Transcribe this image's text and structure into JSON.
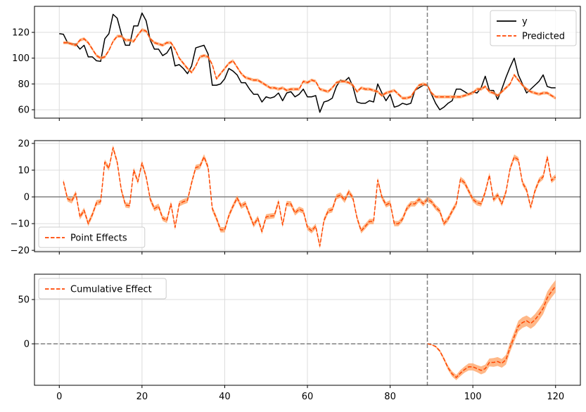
{
  "chart_data": [
    {
      "type": "line",
      "panel": "top",
      "xlim": [
        -6,
        126
      ],
      "ylim": [
        53.5,
        140.2
      ],
      "xticks": [
        0,
        20,
        40,
        60,
        80,
        100,
        120
      ],
      "yticks": [
        60,
        80,
        100,
        120
      ],
      "grid": true,
      "legend_placement": "top-right",
      "intervention_x": 89,
      "series": [
        {
          "name": "y",
          "color": "#000000",
          "style": "solid",
          "x_start": 0,
          "values": [
            119,
            118.5,
            112,
            111,
            111,
            107,
            110,
            101,
            101,
            98,
            97.5,
            115,
            119,
            134,
            131,
            119,
            110,
            110,
            125,
            125,
            135,
            129,
            114,
            107,
            107,
            102,
            104,
            109,
            94,
            95,
            92,
            88,
            94,
            108,
            109,
            110,
            103,
            79,
            79,
            80,
            84,
            92,
            90,
            87,
            81,
            81,
            76,
            72,
            72,
            66,
            70,
            69,
            70,
            73,
            67,
            73,
            74,
            70,
            72,
            76,
            70,
            70,
            71,
            58,
            66,
            67,
            69,
            78,
            83,
            82,
            85,
            78,
            66,
            65,
            65,
            67,
            66,
            80,
            73,
            67,
            72,
            62,
            63,
            65,
            64,
            65,
            75,
            77,
            79,
            79,
            72,
            65,
            60,
            62,
            65,
            67,
            76,
            76,
            74,
            72,
            74,
            73,
            77,
            86,
            75,
            75,
            68,
            76,
            85,
            93,
            100,
            87,
            80,
            73,
            76,
            79,
            82,
            87,
            78,
            77,
            77
          ]
        },
        {
          "name": "Predicted",
          "color": "#ff4500",
          "style": "dashed",
          "x_start": 1,
          "band_halfwidth": 1.2,
          "band_color": "#ffa060",
          "values": [
            112,
            112,
            111,
            110,
            114,
            115,
            112,
            107,
            102,
            100,
            101,
            106,
            113,
            117,
            117,
            114,
            114,
            113,
            118,
            122,
            121,
            115,
            112,
            111,
            110,
            112,
            112,
            107,
            100,
            96,
            92,
            89,
            94,
            101,
            102,
            101,
            95,
            84,
            88,
            92,
            96,
            98,
            93,
            88,
            85,
            84,
            83,
            83,
            81,
            79,
            77,
            77,
            76,
            77,
            75,
            76,
            76,
            76,
            82,
            81,
            83,
            82,
            76,
            75,
            74,
            77,
            81,
            82,
            82,
            81,
            79,
            74,
            77,
            76,
            76,
            75,
            74,
            71,
            73,
            74,
            75,
            72,
            69,
            69,
            70,
            75,
            79,
            80,
            79,
            73,
            70,
            70,
            70,
            70,
            70,
            70,
            70,
            71,
            72,
            73,
            76,
            76,
            78,
            74,
            73,
            71,
            74,
            77,
            80,
            87,
            83,
            79,
            76,
            74,
            73,
            72,
            73,
            73,
            71,
            69
          ]
        }
      ]
    },
    {
      "type": "line",
      "panel": "middle",
      "xlim": [
        -6,
        126
      ],
      "ylim": [
        -20.5,
        21.05
      ],
      "xticks": [
        0,
        20,
        40,
        60,
        80,
        100,
        120
      ],
      "yticks": [
        -20,
        -10,
        0,
        10,
        20
      ],
      "grid": true,
      "legend_placement": "lower-left",
      "intervention_x": 89,
      "zero_line": "solid",
      "series": [
        {
          "name": "Point Effects",
          "color": "#ff4500",
          "style": "dashed",
          "x_start": 1,
          "band_halfwidth": 1.0,
          "band_color": "#ffa060",
          "values": [
            5.7,
            -0.7,
            -1.5,
            1.3,
            -7.5,
            -5,
            -10,
            -6.6,
            -2.2,
            -1.8,
            13,
            10.7,
            18.4,
            13,
            2.6,
            -3,
            -3.3,
            10,
            5.7,
            12.7,
            7.5,
            -0.9,
            -4.4,
            -3.5,
            -8,
            -8.8,
            -2.6,
            -11.4,
            -2.6,
            -1.8,
            -1.3,
            5.3,
            11,
            11.4,
            15,
            11,
            -4.4,
            -8,
            -12.3,
            -12.3,
            -7,
            -3.5,
            -0.4,
            -3.5,
            -2.5,
            -6.6,
            -10.5,
            -8,
            -13,
            -7.5,
            -7.2,
            -7,
            -1.8,
            -10.5,
            -2.5,
            -2.6,
            -6,
            -4.6,
            -5.3,
            -11.4,
            -12.7,
            -11,
            -18.4,
            -8.8,
            -5.3,
            -4.8,
            0,
            0.7,
            -1.3,
            1.9,
            -0.4,
            -7.9,
            -12.7,
            -11,
            -9.2,
            -9.2,
            6.3,
            0,
            -3,
            -2.2,
            -10,
            -10,
            -8.3,
            -4.4,
            -2.6,
            -2.6,
            -0.9,
            -2.6,
            -0.9,
            -1.8,
            -3.9,
            -5.3,
            -10,
            -8.3,
            -5.3,
            -2.6,
            6.6,
            5.3,
            2.2,
            -0.9,
            -2.2,
            -2.6,
            1.8,
            8.1,
            -1,
            0.7,
            -2.6,
            1.8,
            10.5,
            14.9,
            13.9,
            5.3,
            2.6,
            -3.9,
            2.2,
            6.1,
            7.5,
            14.9,
            6.1,
            7.5
          ]
        }
      ]
    },
    {
      "type": "line",
      "panel": "bottom",
      "xlim": [
        -6,
        126
      ],
      "ylim": [
        -46.8,
        78.6
      ],
      "xticks": [
        0,
        20,
        40,
        60,
        80,
        100,
        120
      ],
      "xtick_labels": [
        "0",
        "20",
        "40",
        "60",
        "80",
        "100",
        "120"
      ],
      "yticks": [
        0,
        50
      ],
      "grid": true,
      "legend_placement": "upper-left",
      "intervention_x": 89,
      "zero_line": "dashed",
      "series": [
        {
          "name": "Cumulative Effect",
          "color": "#ff4500",
          "style": "dashed",
          "x_start": 89,
          "band_color": "#ffa060",
          "values": [
            0,
            -1,
            -3,
            -8,
            -17,
            -27,
            -34,
            -38,
            -33,
            -29,
            -26,
            -26,
            -28,
            -30,
            -28,
            -21,
            -21,
            -20,
            -22,
            -18,
            -4,
            8,
            20,
            24,
            26,
            23,
            27,
            33,
            40,
            52,
            59,
            65
          ],
          "band_halfwidth": [
            0,
            0.5,
            1,
            1.5,
            2,
            2.5,
            3,
            3,
            3.5,
            3.5,
            4,
            4,
            4,
            4.5,
            4.5,
            4.5,
            5,
            5,
            5,
            5.5,
            5.5,
            5.5,
            6,
            6,
            6,
            6,
            6.5,
            6.5,
            6.5,
            7,
            7,
            7
          ]
        }
      ]
    }
  ],
  "colors": {
    "grid": "#dcdcdc",
    "reference_line": "#808080"
  }
}
